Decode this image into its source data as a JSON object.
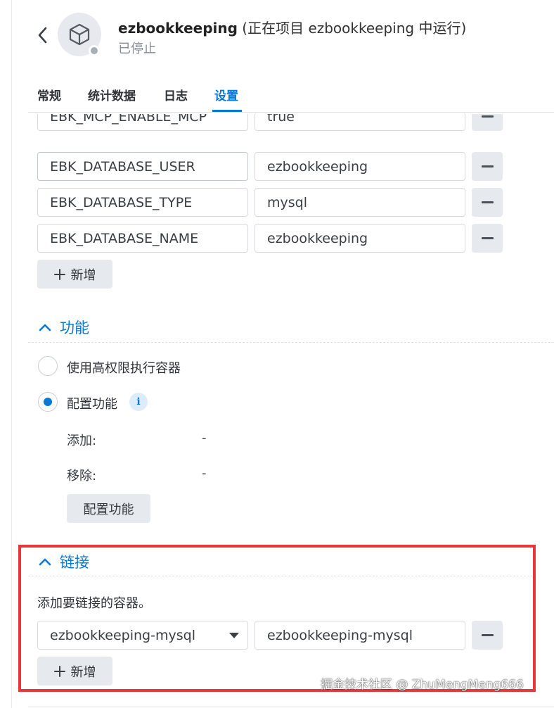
{
  "header": {
    "container_name": "ezbookkeeping",
    "project_text": " (正在项目 ezbookkeeping 中运行)",
    "status": "已停止",
    "icons": {
      "back": "chevron-left-icon",
      "avatar": "cube-icon"
    },
    "status_dot_color": "#a9afb7"
  },
  "tabs": [
    {
      "label": "常规",
      "active": false
    },
    {
      "label": "统计数据",
      "active": false
    },
    {
      "label": "日志",
      "active": false
    },
    {
      "label": "设置",
      "active": true
    }
  ],
  "env_vars": {
    "rows": [
      {
        "key": "EBK_MCP_ENABLE_MCP",
        "value": "true"
      },
      {
        "key": "EBK_DATABASE_USER",
        "value": "ezbookkeeping"
      },
      {
        "key": "EBK_DATABASE_TYPE",
        "value": "mysql"
      },
      {
        "key": "EBK_DATABASE_NAME",
        "value": "ezbookkeeping"
      }
    ],
    "add_label": "新增"
  },
  "capabilities": {
    "title": "功能",
    "option_privileged": "使用高权限执行容器",
    "option_configure": "配置功能",
    "selected": "configure",
    "add_label": "添加:",
    "add_value": "-",
    "remove_label": "移除:",
    "remove_value": "-",
    "button": "配置功能"
  },
  "links": {
    "title": "链接",
    "description": "添加要链接的容器。",
    "rows": [
      {
        "container": "ezbookkeeping-mysql",
        "alias": "ezbookkeeping-mysql"
      }
    ],
    "add_label": "新增"
  },
  "watermark": "掘金技术社区 @ ZhuMengMeng666",
  "colors": {
    "accent": "#0a78d7",
    "highlight": "#e8373c"
  }
}
